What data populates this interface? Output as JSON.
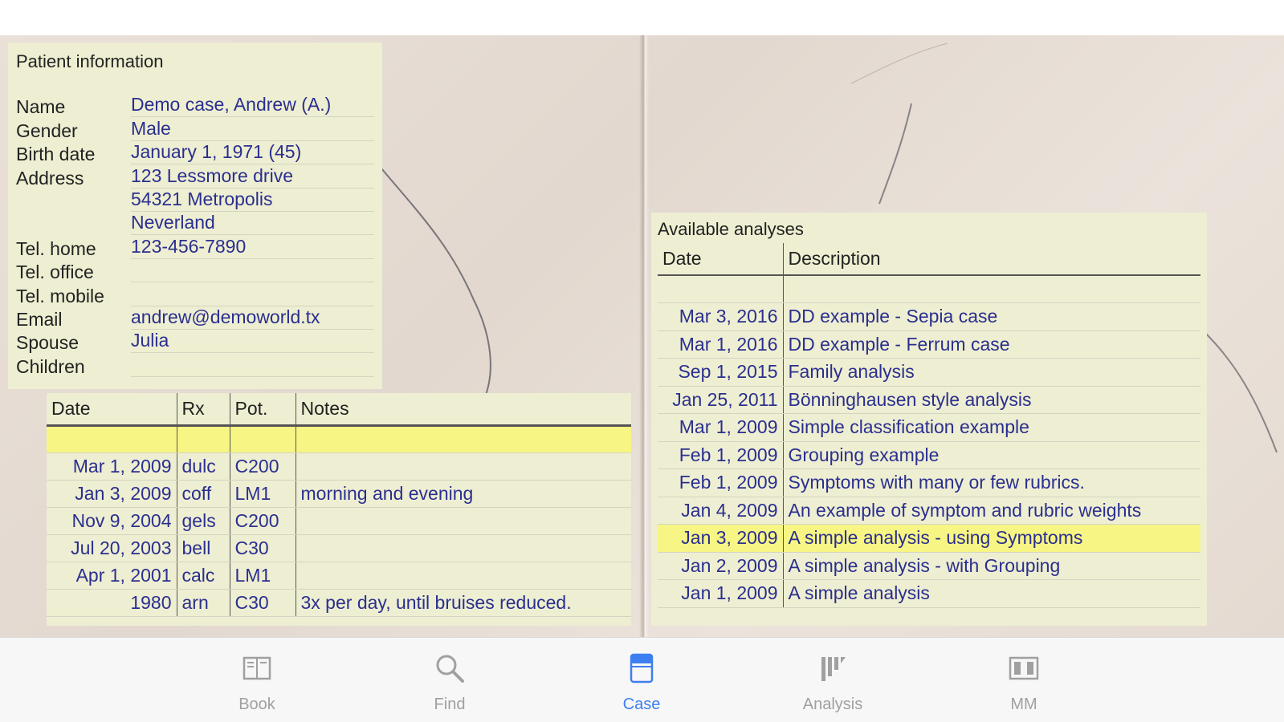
{
  "patient": {
    "title": "Patient information",
    "rows": [
      {
        "label": "Name",
        "value": "Demo case, Andrew (A.)"
      },
      {
        "label": "Gender",
        "value": "Male"
      },
      {
        "label": "Birth date",
        "value": "January 1, 1971 (45)"
      },
      {
        "label": "Address",
        "value": "123 Lessmore drive"
      },
      {
        "label": "",
        "value": "54321  Metropolis"
      },
      {
        "label": "",
        "value": "Neverland"
      },
      {
        "label": "Tel. home",
        "value": "123-456-7890"
      },
      {
        "label": "Tel. office",
        "value": ""
      },
      {
        "label": "Tel. mobile",
        "value": ""
      },
      {
        "label": "Email",
        "value": "andrew@demoworld.tx"
      },
      {
        "label": "Spouse",
        "value": "Julia"
      },
      {
        "label": "Children",
        "value": ""
      }
    ]
  },
  "treatments": {
    "headers": {
      "date": "Date",
      "rx": "Rx",
      "pot": "Pot.",
      "notes": "Notes"
    },
    "rows": [
      {
        "date": "",
        "rx": "",
        "pot": "",
        "notes": ""
      },
      {
        "date": "Mar 1, 2009",
        "rx": "dulc",
        "pot": "C200",
        "notes": ""
      },
      {
        "date": "Jan 3, 2009",
        "rx": "coff",
        "pot": "LM1",
        "notes": "morning and evening"
      },
      {
        "date": "Nov 9, 2004",
        "rx": "gels",
        "pot": "C200",
        "notes": ""
      },
      {
        "date": "Jul 20, 2003",
        "rx": "bell",
        "pot": "C30",
        "notes": ""
      },
      {
        "date": "Apr 1, 2001",
        "rx": "calc",
        "pot": "LM1",
        "notes": ""
      },
      {
        "date": "1980",
        "rx": "arn",
        "pot": "C30",
        "notes": "3x per day, until bruises reduced."
      }
    ]
  },
  "analyses": {
    "title": "Available analyses",
    "headers": {
      "date": "Date",
      "description": "Description"
    },
    "rows": [
      {
        "date": "",
        "description": ""
      },
      {
        "date": "Mar 3, 2016",
        "description": "DD example - Sepia case"
      },
      {
        "date": "Mar 1, 2016",
        "description": "DD example - Ferrum case"
      },
      {
        "date": "Sep 1, 2015",
        "description": "Family analysis"
      },
      {
        "date": "Jan 25, 2011",
        "description": "Bönninghausen style analysis"
      },
      {
        "date": "Mar 1, 2009",
        "description": "Simple classification example"
      },
      {
        "date": "Feb 1, 2009",
        "description": "Grouping example"
      },
      {
        "date": "Feb 1, 2009",
        "description": "Symptoms with many or few rubrics."
      },
      {
        "date": "Jan 4, 2009",
        "description": "An example of symptom and rubric weights"
      },
      {
        "date": "Jan 3, 2009",
        "description": "A simple analysis - using Symptoms"
      },
      {
        "date": "Jan 2, 2009",
        "description": "A simple analysis - with Grouping"
      },
      {
        "date": "Jan 1, 2009",
        "description": "A simple analysis"
      }
    ]
  },
  "tabs": [
    {
      "label": "Book",
      "icon": "book-icon"
    },
    {
      "label": "Find",
      "icon": "magnifier-icon"
    },
    {
      "label": "Case",
      "icon": "case-icon"
    },
    {
      "label": "Analysis",
      "icon": "analysis-icon"
    },
    {
      "label": "MM",
      "icon": "materia-medica-icon"
    }
  ],
  "active_tab": "Case",
  "colors": {
    "panel_bg": "#eeeed2",
    "value_text": "#2a2f8f",
    "highlight": "#f7f584",
    "active_tab": "#3d7ff0",
    "inactive_tab": "#a0a0a0"
  }
}
